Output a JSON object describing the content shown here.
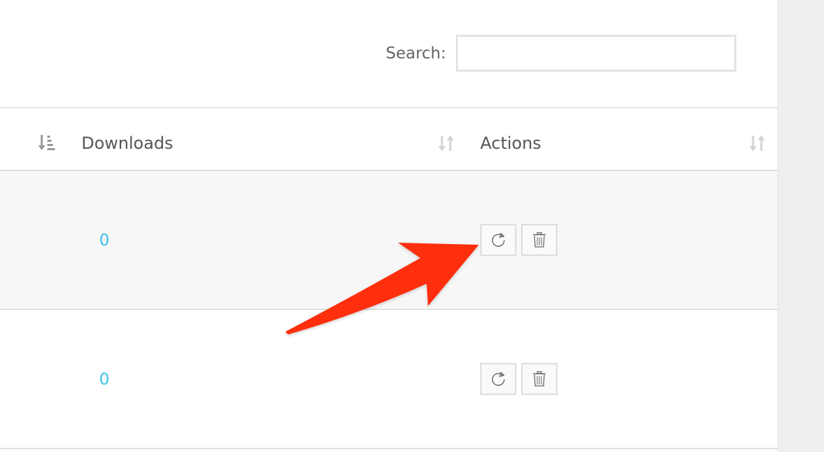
{
  "search": {
    "label": "Search:",
    "value": "",
    "placeholder": ""
  },
  "table": {
    "columns": [
      {
        "label": "Downloads"
      },
      {
        "label": "Actions"
      }
    ],
    "rows": [
      {
        "downloads": "0"
      },
      {
        "downloads": "0"
      }
    ]
  },
  "colors": {
    "link": "#3cc2e8",
    "annotation_arrow": "#ff2d0a"
  },
  "icons": {
    "sort_active": "sort-amount-down-icon",
    "sort": "sort-icon",
    "refresh": "refresh-icon",
    "delete": "trash-icon"
  }
}
